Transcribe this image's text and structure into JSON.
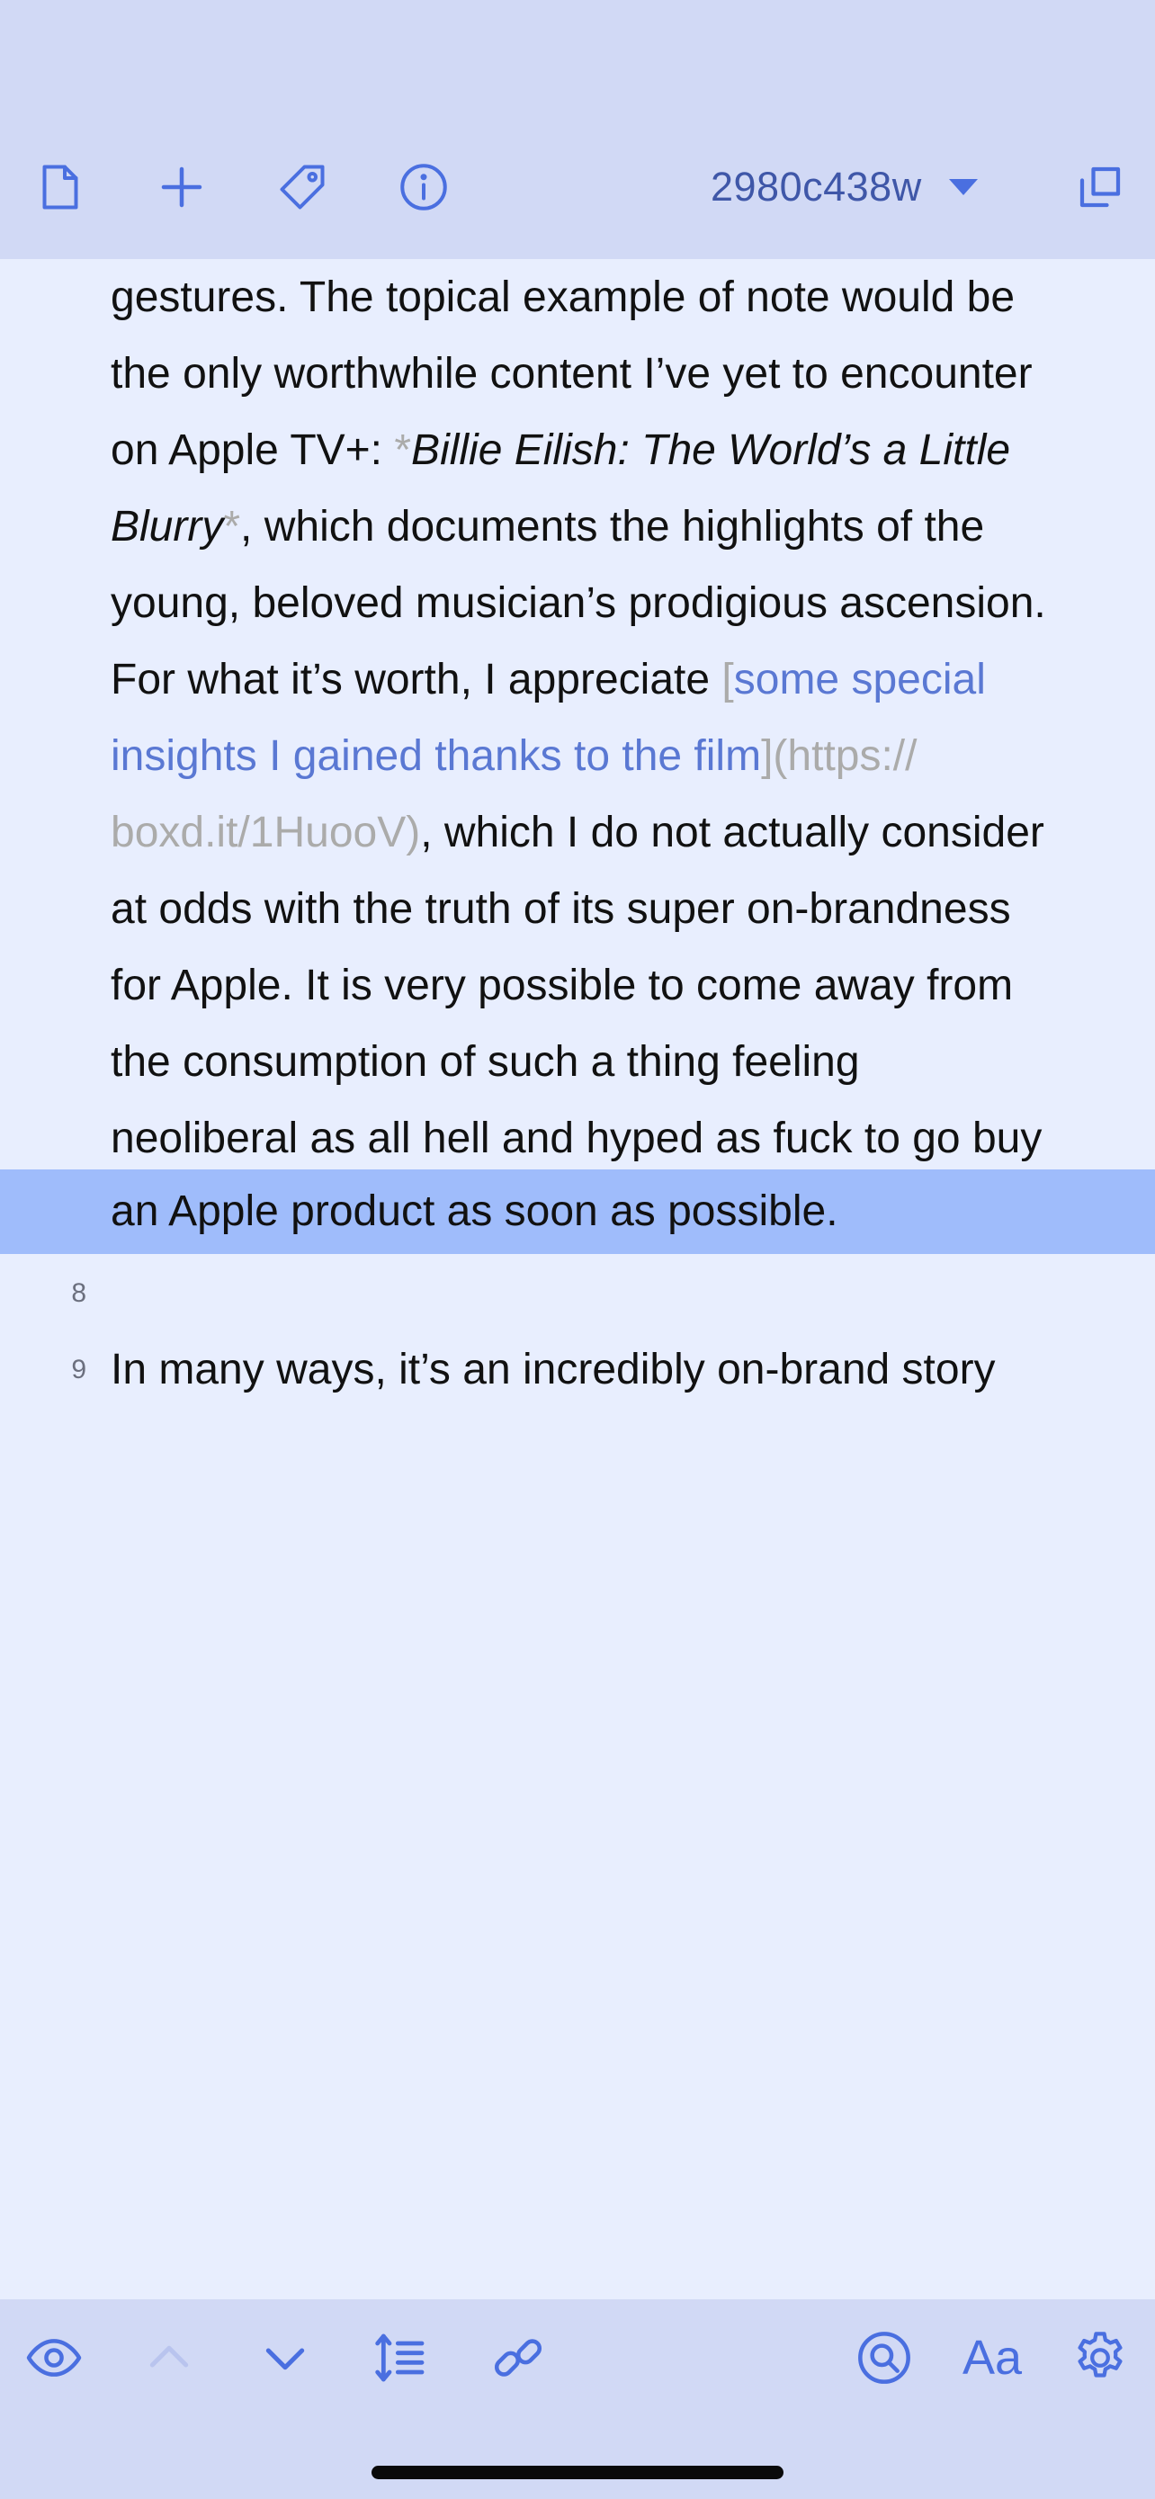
{
  "toolbar": {
    "document_title": "2980c438w",
    "icons": {
      "new_document": "document-icon",
      "add": "plus-icon",
      "tags": "tag-icon",
      "info": "info-icon",
      "expand": "expand-icon"
    }
  },
  "editor": {
    "lines": [
      "gestures. The topical example of note would be",
      "the only worthwhile content I’ve yet to encounter",
      {
        "prefix": "on Apple TV+: ",
        "marker_open": "*",
        "italic": "Billie Eilish: The World’s a Little"
      },
      {
        "italic": "Blurry",
        "marker_close": "*",
        "suffix": ", which documents the highlights of the"
      },
      "young, beloved musician’s prodigious ascension.",
      {
        "prefix": "For what it’s worth, I appreciate ",
        "bracket_open": "[",
        "link": "some special"
      },
      {
        "link": "insights I gained thanks to the film",
        "bracket_close": "]",
        "url_start": "(https://"
      },
      {
        "url_end": "boxd.it/1HuooV)",
        "suffix": ", which I do not actually consider"
      },
      "at odds with the truth of its super on-brandness",
      "for Apple. It is very possible to come away from",
      "the consumption of such a thing feeling",
      "neoliberal as all hell and hyped as fuck to go buy",
      "an Apple product as soon as possible."
    ],
    "line8_number": "8",
    "line9_number": "9",
    "line9_text": "In many ways, it’s an incredibly on-brand story"
  },
  "bottom_toolbar": {
    "icons": {
      "preview": "eye-icon",
      "previous": "chevron-up-icon",
      "next": "chevron-down-icon",
      "outline": "line-height-list-icon",
      "link": "link-icon",
      "search": "search-icon",
      "font": "font-icon",
      "settings": "gear-icon"
    },
    "font_label": "Aa"
  },
  "colors": {
    "accent": "#4a6fe0",
    "toolbar_bg": "#d1d9f5",
    "editor_bg": "#e8eefe",
    "highlight": "#9fbcfb",
    "markup_gray": "#ababaa",
    "link_blue": "#5a78d3"
  }
}
